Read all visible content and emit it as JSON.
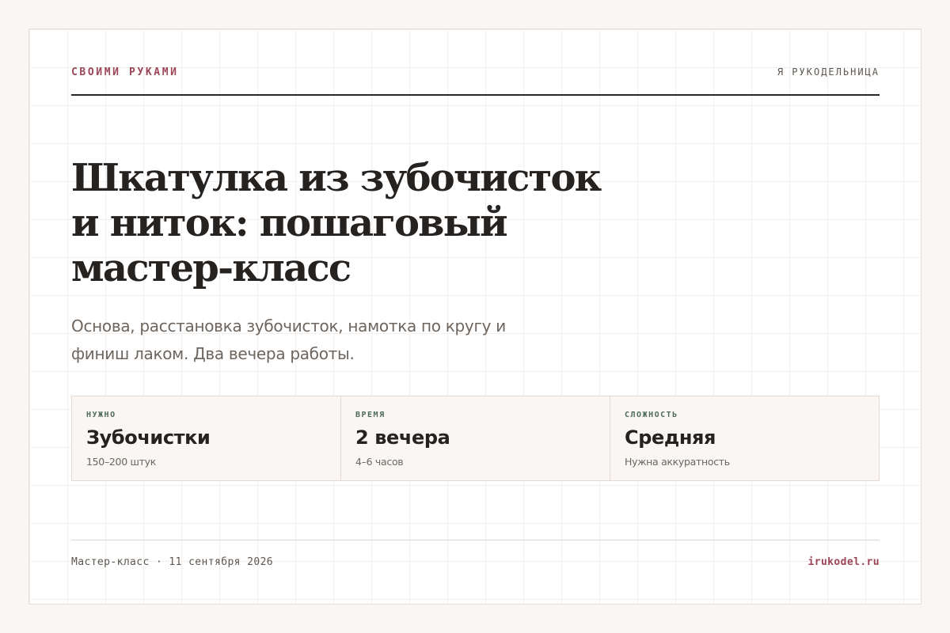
{
  "header": {
    "brand": "СВОИМИ РУКАМИ",
    "author": "Я РУКОДЕЛЬНИЦА"
  },
  "article": {
    "title_lines": [
      "Шкатулка из зубочисток",
      "и ниток: пошаговый",
      "мастер-класс"
    ],
    "lede_lines": [
      "Основа, расстановка зубочисток, намотка по кругу и",
      "финиш лаком. Два вечера работы."
    ]
  },
  "facts": [
    {
      "label": "НУЖНО",
      "value": "Зубочистки",
      "note": "150–200 штук"
    },
    {
      "label": "ВРЕМЯ",
      "value": "2 вечера",
      "note": "4–6 часов"
    },
    {
      "label": "СЛОЖНОСТЬ",
      "value": "Средняя",
      "note": "Нужна аккуратность"
    }
  ],
  "footer": {
    "meta": "Мастер-класс · 11 сентября 2026",
    "site": "irukodel.ru"
  },
  "colors": {
    "accent": "#9c4556",
    "label_green": "#4f6b59",
    "ink": "#262220",
    "muted": "#6d655e",
    "page_background": "#f9f6f3"
  }
}
